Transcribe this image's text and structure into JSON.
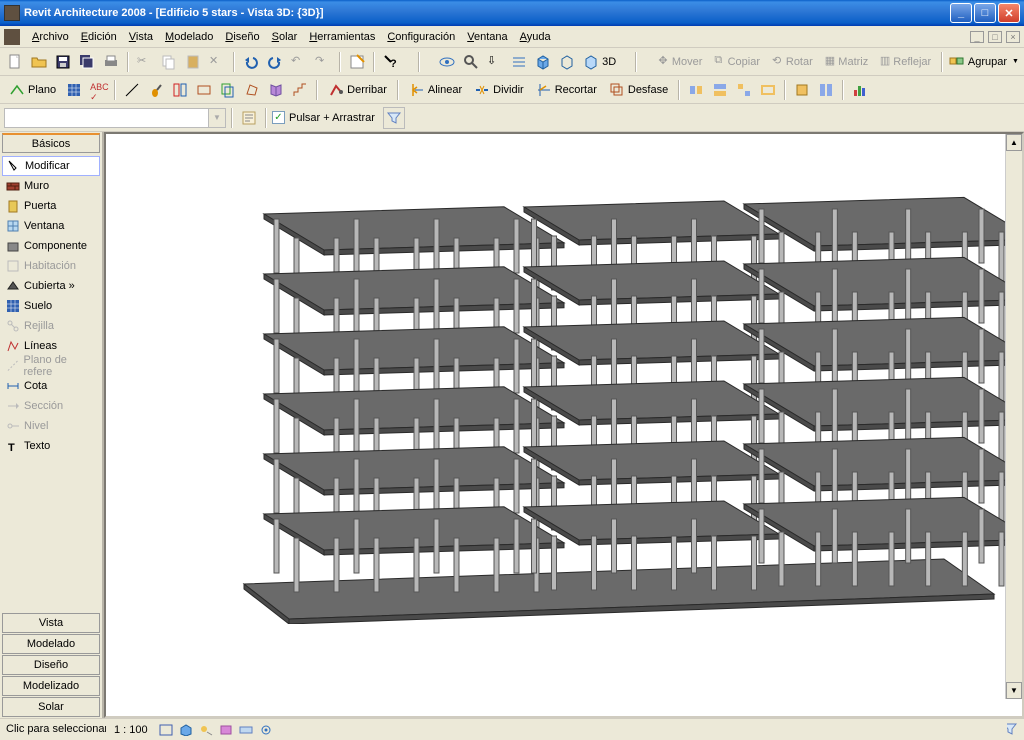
{
  "title": "Revit Architecture 2008 - [Edificio 5 stars - Vista 3D: {3D}]",
  "menus": [
    "Archivo",
    "Edición",
    "Vista",
    "Modelado",
    "Diseño",
    "Solar",
    "Herramientas",
    "Configuración",
    "Ventana",
    "Ayuda"
  ],
  "toolbar2": {
    "plano": "Plano",
    "derribar": "Derribar",
    "alinear": "Alinear",
    "dividir": "Dividir",
    "recortar": "Recortar",
    "desfase": "Desfase"
  },
  "toolbar1": {
    "mover": "Mover",
    "copiar": "Copiar",
    "rotar": "Rotar",
    "matriz": "Matriz",
    "reflejar": "Reflejar",
    "agrupar": "Agrupar",
    "threeD": "3D"
  },
  "toolbar3": {
    "pulsar": "Pulsar + Arrastrar"
  },
  "side_tabs_top": "Básicos",
  "side_tools": [
    {
      "label": "Modificar",
      "dis": false,
      "sel": true
    },
    {
      "label": "Muro",
      "dis": false
    },
    {
      "label": "Puerta",
      "dis": false
    },
    {
      "label": "Ventana",
      "dis": false
    },
    {
      "label": "Componente",
      "dis": false
    },
    {
      "label": "Habitación",
      "dis": true
    },
    {
      "label": "Cubierta »",
      "dis": false
    },
    {
      "label": "Suelo",
      "dis": false
    },
    {
      "label": "Rejilla",
      "dis": true
    },
    {
      "label": "Líneas",
      "dis": false
    },
    {
      "label": "Plano de refere",
      "dis": true
    },
    {
      "label": "Cota",
      "dis": false
    },
    {
      "label": "Sección",
      "dis": true
    },
    {
      "label": "Nivel",
      "dis": true
    },
    {
      "label": "Texto",
      "dis": false
    }
  ],
  "side_tabs_bottom": [
    "Vista",
    "Modelado",
    "Diseño",
    "Modelizado",
    "Solar"
  ],
  "scale": "1 : 100",
  "status": "Clic para seleccionar, TAB para alternar, CTRL para añadir y MAYÚS para anular una selección."
}
